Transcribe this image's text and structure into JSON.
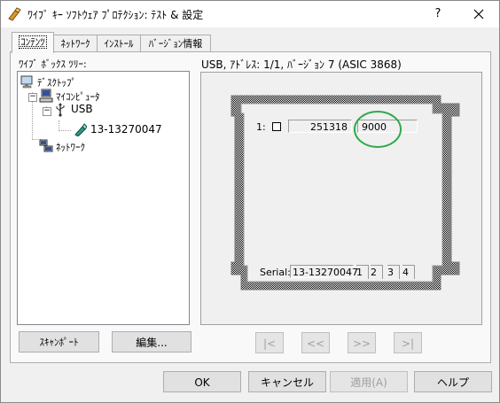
{
  "window": {
    "title": "ﾜｲﾌﾞ ｷｰ ｿﾌﾄｳｪｱ ﾌﾟﾛﾃｸｼｮﾝ: ﾃｽﾄ & 設定",
    "help_label": "?",
    "close_icon": "close-icon"
  },
  "tabs": [
    {
      "label": "ｺﾝﾃﾝﾂ",
      "active": true
    },
    {
      "label": "ﾈｯﾄﾜｰｸ",
      "active": false
    },
    {
      "label": "ｲﾝｽﾄｰﾙ",
      "active": false
    },
    {
      "label": "ﾊﾞｰｼﾞｮﾝ情報",
      "active": false
    }
  ],
  "tree": {
    "label": "ﾜｲﾌﾞ ﾎﾞｯｸｽ ﾂﾘｰ:",
    "items": [
      {
        "label": "ﾃﾞｽｸﾄｯﾌﾟ",
        "icon": "desktop-icon"
      },
      {
        "label": "ﾏｲｺﾝﾋﾟｭｰﾀ",
        "icon": "computer-icon",
        "expander": "−"
      },
      {
        "label": "USB",
        "icon": "usb-icon",
        "expander": "−"
      },
      {
        "label": "13-13270047",
        "icon": "usb-key-icon",
        "selected": true
      },
      {
        "label": "ﾈｯﾄﾜｰｸ",
        "icon": "network-icon"
      }
    ]
  },
  "device": {
    "label": "USB, ｱﾄﾞﾚｽ: 1/1, ﾊﾞｰｼﾞｮﾝ 7 (ASIC 3868)",
    "slot": {
      "index": "1:",
      "value_a": "251318",
      "value_b": "9000"
    },
    "serial": {
      "label": "Serial:",
      "value": "13-13270047",
      "ports": [
        "1",
        "2",
        "3",
        "4"
      ]
    },
    "annotation_color": "#2ea84a"
  },
  "buttons": {
    "scan": "ｽｷｬﾝﾎﾟｰﾄ",
    "edit": "編集...",
    "nav_first": "|<",
    "nav_prev": "<<",
    "nav_next": ">>",
    "nav_last": ">|",
    "ok": "OK",
    "cancel": "キャンセル",
    "apply": "適用(A)",
    "help": "ヘルプ"
  }
}
